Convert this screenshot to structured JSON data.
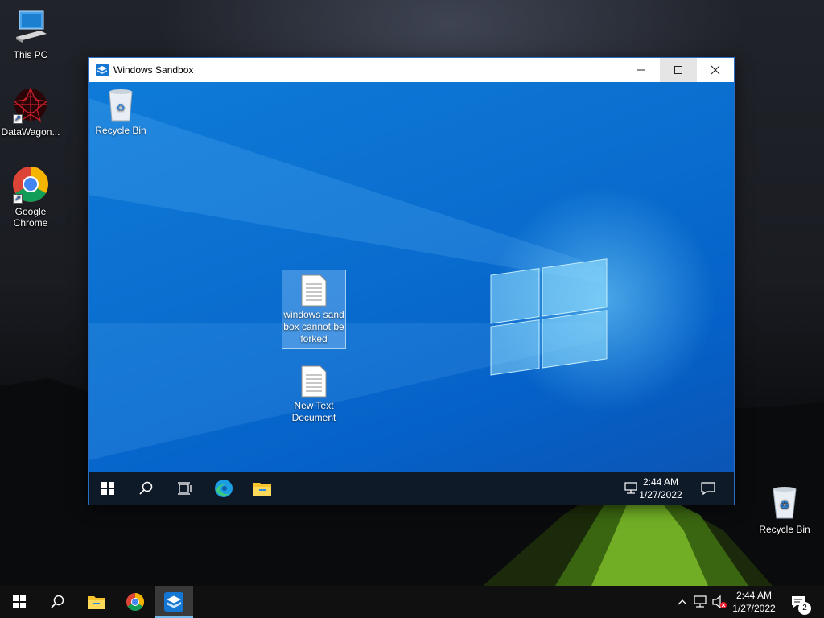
{
  "host_desktop": {
    "icons": [
      {
        "label": "This PC"
      },
      {
        "label": "DataWagon..."
      },
      {
        "label": "Google Chrome"
      },
      {
        "label": "Recycle Bin"
      }
    ]
  },
  "sandbox_window": {
    "title": "Windows Sandbox",
    "controls": {
      "minimize": "—",
      "maximize": "☐",
      "close": "✕"
    },
    "desktop": {
      "icons": [
        {
          "label": "Recycle Bin"
        },
        {
          "label": "windows sand box cannot be forked",
          "selected": true
        },
        {
          "label": "New Text Document"
        }
      ]
    },
    "taskbar": {
      "time": "2:44 AM",
      "date": "1/27/2022"
    }
  },
  "taskbar": {
    "pinned": [
      "Start",
      "Search",
      "File Explorer",
      "Google Chrome",
      "Windows Sandbox"
    ],
    "active_app": "Windows Sandbox",
    "time": "2:44 AM",
    "date": "1/27/2022",
    "notification_count": "2"
  },
  "colors": {
    "sandbox_accent": "#0078d7",
    "taskbar": "#101010",
    "active_indicator": "#76b9ed"
  }
}
